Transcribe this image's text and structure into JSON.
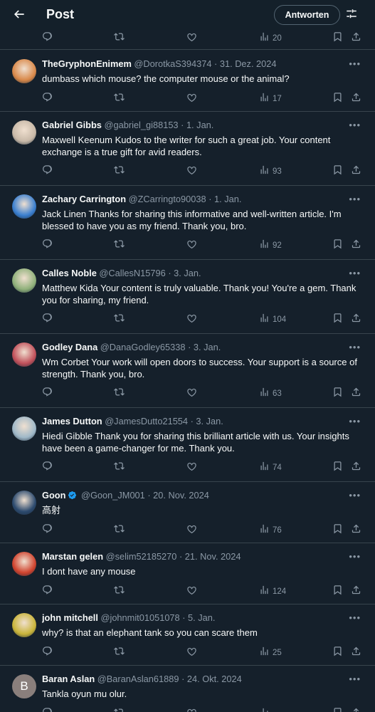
{
  "header": {
    "title": "Post",
    "reply_button": "Antworten"
  },
  "top_actions": {
    "views": "20"
  },
  "tweets": [
    {
      "name": "TheGryphonEnimem",
      "handle": "@DorotkaS394374",
      "date": "31. Dez. 2024",
      "text": "dumbass which mouse? the computer mouse or the animal?",
      "views": "17",
      "avatar_color": "#d9894a"
    },
    {
      "name": "Gabriel Gibbs",
      "handle": "@gabriel_gi88153",
      "date": "1. Jan.",
      "text": "Maxwell Keenum Kudos to the writer for such a great job. Your content exchange is a true gift for avid readers.",
      "views": "93",
      "avatar_color": "#c8b9a8"
    },
    {
      "name": "Zachary Carrington",
      "handle": "@ZCarringto90038",
      "date": "1. Jan.",
      "text": "Jack Linen Thanks for sharing this informative and well-written article. I'm blessed to have you as my friend. Thank you, bro.",
      "views": "92",
      "avatar_color": "#3a7fd0"
    },
    {
      "name": "Calles Noble",
      "handle": "@CallesN15796",
      "date": "3. Jan.",
      "text": "Matthew Kida Your content is truly valuable. Thank you! You're a gem. Thank you for sharing, my friend.",
      "views": "104",
      "avatar_color": "#8fb07a"
    },
    {
      "name": "Godley Dana",
      "handle": "@DanaGodley65338",
      "date": "3. Jan.",
      "text": "Wm Corbet Your work will open doors to success. Your support is a source of strength. Thank you, bro.",
      "views": "63",
      "avatar_color": "#c0505a"
    },
    {
      "name": "James Dutton",
      "handle": "@JamesDutto21554",
      "date": "3. Jan.",
      "text": "Hiedi Gibble Thank you for sharing this brilliant article with us. Your insights have been a game-changer for me. Thank you.",
      "views": "74",
      "avatar_color": "#9fb8c8"
    },
    {
      "name": "Goon",
      "handle": "@Goon_JM001",
      "date": "20. Nov. 2024",
      "text": "高射",
      "views": "76",
      "verified": true,
      "avatar_color": "#2c4a6e"
    },
    {
      "name": "Marstan gelen",
      "handle": "@selim52185270",
      "date": "21. Nov. 2024",
      "text": "I dont have any mouse",
      "views": "124",
      "avatar_color": "#d0432e"
    },
    {
      "name": "john mitchell",
      "handle": "@johnmit01051078",
      "date": "5. Jan.",
      "text": "why? is that an elephant tank so you can scare them",
      "views": "25",
      "avatar_color": "#c9b43a"
    },
    {
      "name": "Baran Aslan",
      "handle": "@BaranAslan61889",
      "date": "24. Okt. 2024",
      "text": "Tankla oyun mu olur.",
      "avatar_letter": "B",
      "avatar_color": "#8a7f7c"
    }
  ],
  "colors": {
    "background": "#15202b",
    "divider": "#38444d",
    "text_primary": "#f7f9f9",
    "text_secondary": "#8b98a5",
    "verified_badge": "#1d9bf0"
  },
  "icons": [
    "back-arrow-icon",
    "settings-sliders-icon",
    "reply-icon",
    "retweet-icon",
    "like-icon",
    "views-icon",
    "bookmark-icon",
    "share-icon",
    "more-icon",
    "verified-badge-icon"
  ]
}
